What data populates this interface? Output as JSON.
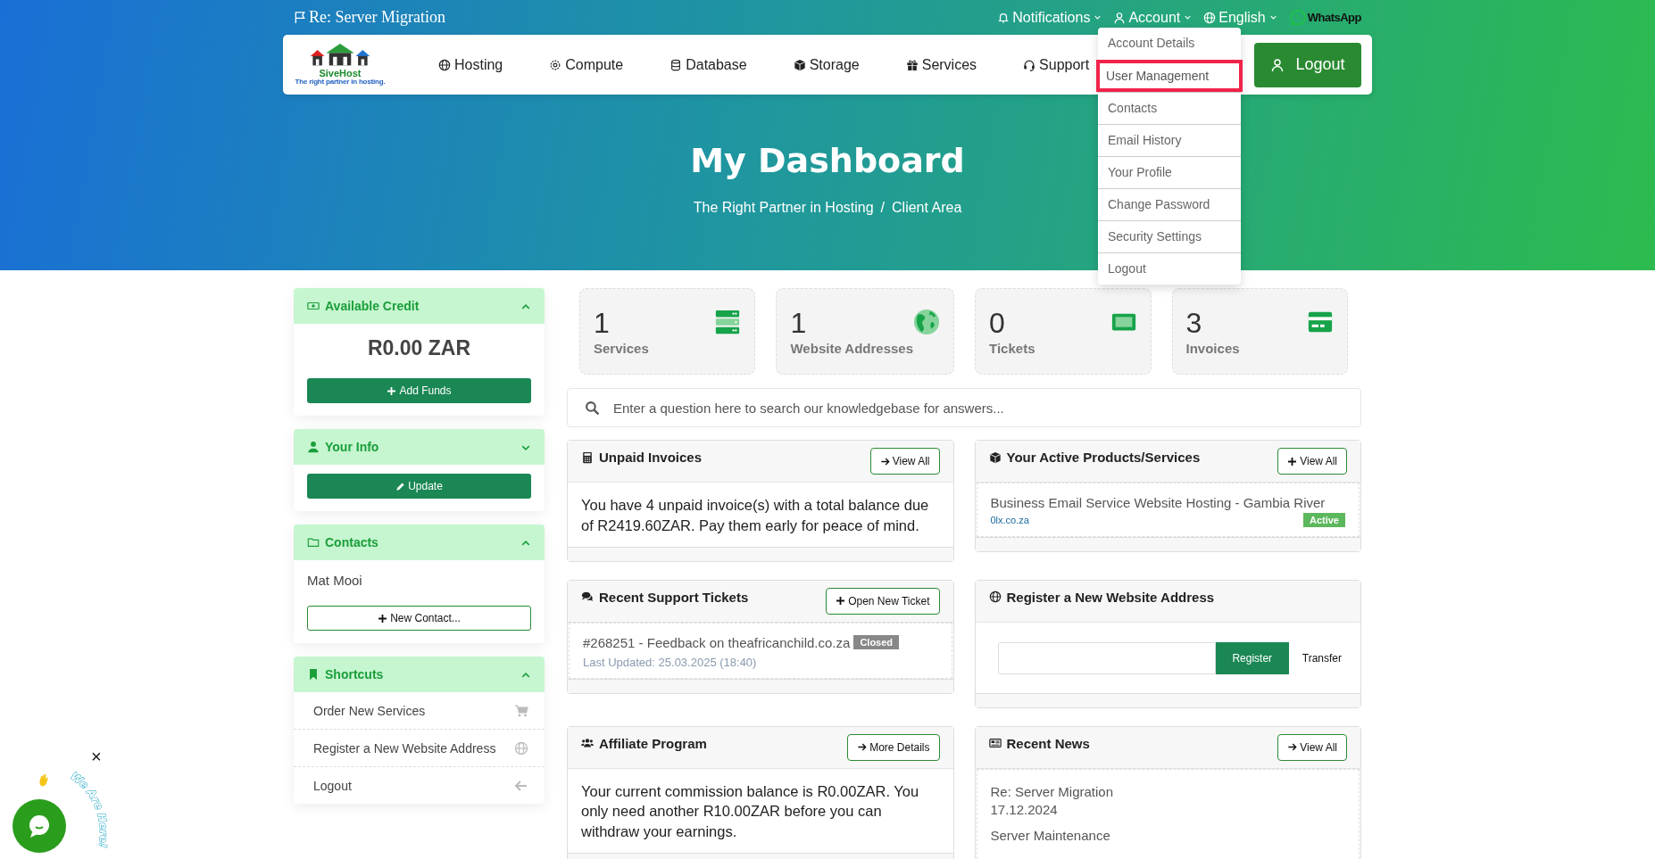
{
  "top_bar": {
    "announcement": "Re: Server Migration",
    "links": [
      {
        "label": "Notifications"
      },
      {
        "label": "Account"
      },
      {
        "label": "English"
      }
    ],
    "whatsapp": "WhatsApp"
  },
  "logo": {
    "name": "SiveHost",
    "tagline": "The right partner in hosting."
  },
  "nav": [
    {
      "label": "Hosting"
    },
    {
      "label": "Compute"
    },
    {
      "label": "Database"
    },
    {
      "label": "Storage"
    },
    {
      "label": "Services"
    },
    {
      "label": "Support"
    }
  ],
  "logout_button": "Logout",
  "account_menu": [
    {
      "label": "Account Details",
      "selected": false
    },
    {
      "label": "User Management",
      "selected": true
    },
    {
      "label": "Contacts",
      "selected": false
    },
    {
      "label": "Email History",
      "selected": false
    },
    {
      "label": "Your Profile",
      "selected": false
    },
    {
      "label": "Change Password",
      "selected": false
    },
    {
      "label": "Security Settings",
      "selected": false
    },
    {
      "label": "Logout",
      "selected": false
    }
  ],
  "hero": {
    "title": "My Dashboard",
    "breadcrumb": [
      "The Right Partner in Hosting",
      "Client Area"
    ],
    "separator": "/"
  },
  "sidebar": [
    {
      "kind": "credit",
      "title": "Available Credit",
      "expanded": true,
      "amount": "R0.00 ZAR",
      "button": "Add Funds"
    },
    {
      "kind": "info",
      "title": "Your Info",
      "expanded": false,
      "button": "Update"
    },
    {
      "kind": "contacts",
      "title": "Contacts",
      "expanded": true,
      "contacts": [
        "Mat Mooi"
      ],
      "button": "New Contact..."
    },
    {
      "kind": "shortcuts",
      "title": "Shortcuts",
      "expanded": true,
      "items": [
        "Order New Services",
        "Register a New Website Address",
        "Logout"
      ]
    }
  ],
  "stats": [
    {
      "count": "1",
      "label": "Services"
    },
    {
      "count": "1",
      "label": "Website Addresses"
    },
    {
      "count": "0",
      "label": "Tickets"
    },
    {
      "count": "3",
      "label": "Invoices"
    }
  ],
  "search": {
    "placeholder": "Enter a question here to search our knowledgebase for answers..."
  },
  "panels": [
    {
      "kind": "invoices",
      "title": "Unpaid Invoices",
      "button": "View All",
      "text": "You have 4 unpaid invoice(s) with a total balance due of R2419.60ZAR. Pay them early for peace of mind."
    },
    {
      "kind": "products",
      "title": "Your Active Products/Services",
      "button": "View All",
      "name": "Business Email Service Website Hosting - Gambia River",
      "domain": "0lx.co.za",
      "status": "Active"
    },
    {
      "kind": "tickets",
      "title": "Recent Support Tickets",
      "button": "Open New Ticket",
      "ticket": "#268251 - Feedback on theafricanchild.co.za",
      "status": "Closed",
      "updated": "Last Updated: 25.03.2025 (18:40)"
    },
    {
      "kind": "domain",
      "title": "Register a New Website Address",
      "register": "Register",
      "transfer": "Transfer"
    },
    {
      "kind": "affiliate",
      "title": "Affiliate Program",
      "button": "More Details",
      "text": "Your current commission balance is R0.00ZAR. You only need another R10.00ZAR before you can withdraw your earnings."
    },
    {
      "kind": "news",
      "title": "Recent News",
      "button": "View All",
      "items": [
        {
          "title": "Re: Server Migration",
          "date": "17.12.2024"
        },
        {
          "title": "Server Maintenance"
        }
      ]
    }
  ],
  "chat_widget": {
    "label": "We Are Here!",
    "close": "×"
  }
}
